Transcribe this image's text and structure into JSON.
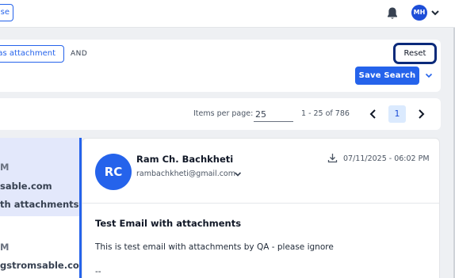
{
  "topbar": {
    "partial_chip": "se",
    "avatar_initials": "MH",
    "icons": {
      "bell": "bell-icon",
      "caret": "chevron-down-icon"
    }
  },
  "search": {
    "filter_chip": "as attachment",
    "operator": "AND",
    "reset_label": "Reset",
    "save_label": "Save Search"
  },
  "pager": {
    "items_per_page_label": "Items per page:",
    "items_per_page_value": "25",
    "range": "1 - 25 of 786",
    "current_page": "1"
  },
  "list": {
    "items": [
      {
        "line1": "M",
        "line2": "sable.com",
        "line3": "th attachments"
      },
      {
        "line1": "M",
        "line2": "gstromsable.com"
      }
    ]
  },
  "email": {
    "avatar_initials": "RC",
    "sender_name": "Ram Ch. Bachkheti",
    "sender_email": "rambachkheti@gmail.com",
    "date": "07/11/2025 - 06:02 PM",
    "subject": "Test Email with attachments",
    "body": "This is test email with attachments by QA - please ignore",
    "signature": "--"
  },
  "colors": {
    "accent": "#2563eb",
    "selected_bg": "#e3e8fb",
    "reset_border": "#0b2a7a"
  }
}
